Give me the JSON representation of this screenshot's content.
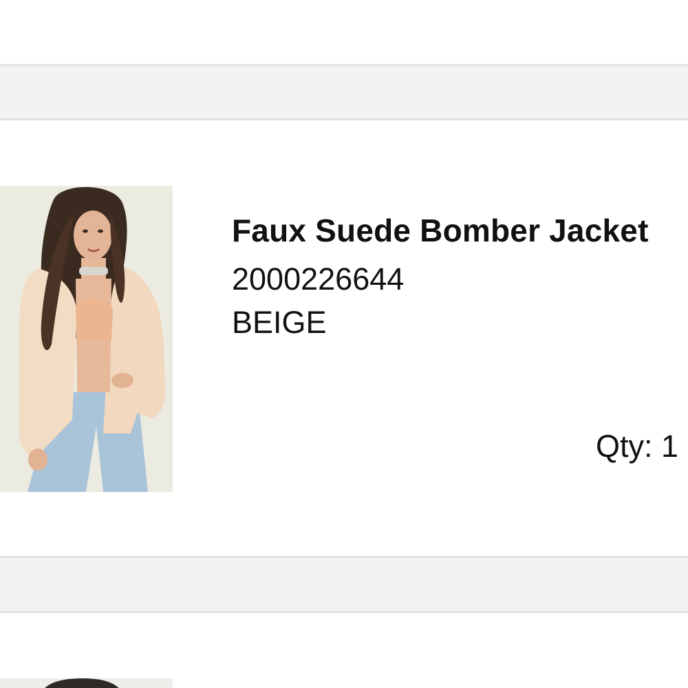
{
  "cart": {
    "items": [
      {
        "image_icon": "product-photo",
        "name": "Faux Suede Bomber Jacket",
        "sku": "2000226644",
        "color": "BEIGE",
        "qty_text": "Qty: 1"
      }
    ]
  },
  "colors": {
    "separator": "#f2f2f2",
    "separator_border": "#e2e2e2",
    "text": "#111111"
  }
}
